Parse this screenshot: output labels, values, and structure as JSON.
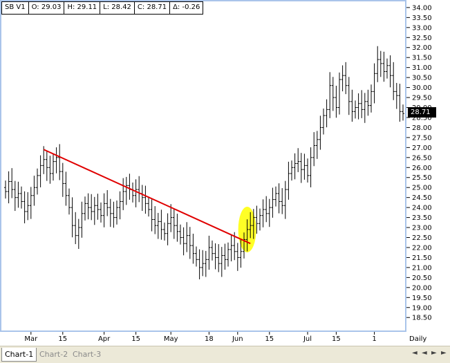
{
  "header": {
    "symbol": "SB V1",
    "open": "O: 29.03",
    "high": "H: 29.11",
    "low": "L: 28.42",
    "close": "C: 28.71",
    "delta": "Δ: -0.26"
  },
  "last_price_label": "28.71",
  "tabs": [
    "Chart-1",
    "Chart-2",
    "Chart-3"
  ],
  "nav": {
    "first": "◄",
    "prev": "◄",
    "next": "►",
    "last": "►"
  },
  "colors": {
    "bars": "#000000",
    "trendline": "#e00000",
    "highlight": "#ffff00",
    "frame": "#a9c4ea"
  },
  "chart_data": {
    "type": "ohlc",
    "periodicity_label": "Daily",
    "y_ticks": [
      "34.00",
      "33.50",
      "33.00",
      "32.50",
      "32.00",
      "31.50",
      "31.00",
      "30.50",
      "30.00",
      "29.50",
      "29.00",
      "28.50",
      "28.00",
      "27.50",
      "27.00",
      "26.50",
      "26.00",
      "25.50",
      "25.00",
      "24.50",
      "24.00",
      "23.50",
      "23.00",
      "22.50",
      "22.00",
      "21.50",
      "21.00",
      "20.50",
      "20.00",
      "19.50",
      "19.00",
      "18.50"
    ],
    "ylim": [
      18.3,
      34.1
    ],
    "x_ticks": [
      {
        "label": "Mar",
        "index": 8
      },
      {
        "label": "15",
        "index": 18
      },
      {
        "label": "Apr",
        "index": 31
      },
      {
        "label": "15",
        "index": 41
      },
      {
        "label": "May",
        "index": 52
      },
      {
        "label": "18",
        "index": 64
      },
      {
        "label": "Jun",
        "index": 73
      },
      {
        "label": "15",
        "index": 83
      },
      {
        "label": "Jul",
        "index": 95
      },
      {
        "label": "15",
        "index": 104
      },
      {
        "label": "1",
        "index": 116
      }
    ],
    "closes": [
      24.8,
      25.3,
      24.9,
      24.5,
      24.7,
      24.3,
      23.8,
      24.1,
      24.6,
      25.0,
      25.6,
      26.1,
      26.4,
      26.0,
      25.7,
      26.3,
      26.5,
      25.8,
      25.2,
      24.6,
      24.0,
      23.1,
      22.6,
      23.0,
      23.7,
      24.2,
      24.0,
      23.8,
      24.1,
      23.9,
      23.6,
      24.2,
      24.0,
      23.7,
      23.5,
      24.0,
      24.3,
      24.8,
      25.1,
      24.9,
      24.6,
      24.9,
      24.7,
      24.5,
      24.2,
      23.9,
      23.4,
      23.1,
      23.3,
      22.9,
      22.7,
      23.2,
      23.5,
      23.1,
      22.8,
      22.5,
      22.2,
      22.6,
      22.1,
      21.7,
      21.4,
      21.0,
      21.2,
      21.4,
      22.0,
      21.7,
      21.5,
      21.2,
      21.6,
      21.4,
      21.9,
      22.1,
      21.8,
      21.5,
      21.8,
      22.4,
      22.9,
      23.1,
      23.5,
      23.2,
      23.6,
      23.9,
      23.7,
      24.0,
      24.4,
      24.7,
      24.3,
      24.1,
      24.9,
      25.7,
      26.0,
      26.2,
      26.3,
      25.9,
      26.1,
      25.6,
      26.5,
      27.1,
      27.4,
      28.0,
      28.6,
      28.9,
      30.1,
      29.5,
      29.0,
      30.4,
      30.6,
      30.1,
      29.3,
      28.8,
      29.0,
      29.2,
      28.9,
      29.3,
      29.1,
      29.8,
      30.7,
      31.4,
      31.2,
      30.8,
      31.1,
      30.6,
      29.8,
      29.6,
      28.8,
      28.7
    ],
    "trendline": {
      "from": {
        "index": 12,
        "value": 26.9
      },
      "to": {
        "index": 77,
        "value": 22.2
      }
    },
    "highlight_ellipse": {
      "index": 76,
      "value": 22.9
    }
  }
}
